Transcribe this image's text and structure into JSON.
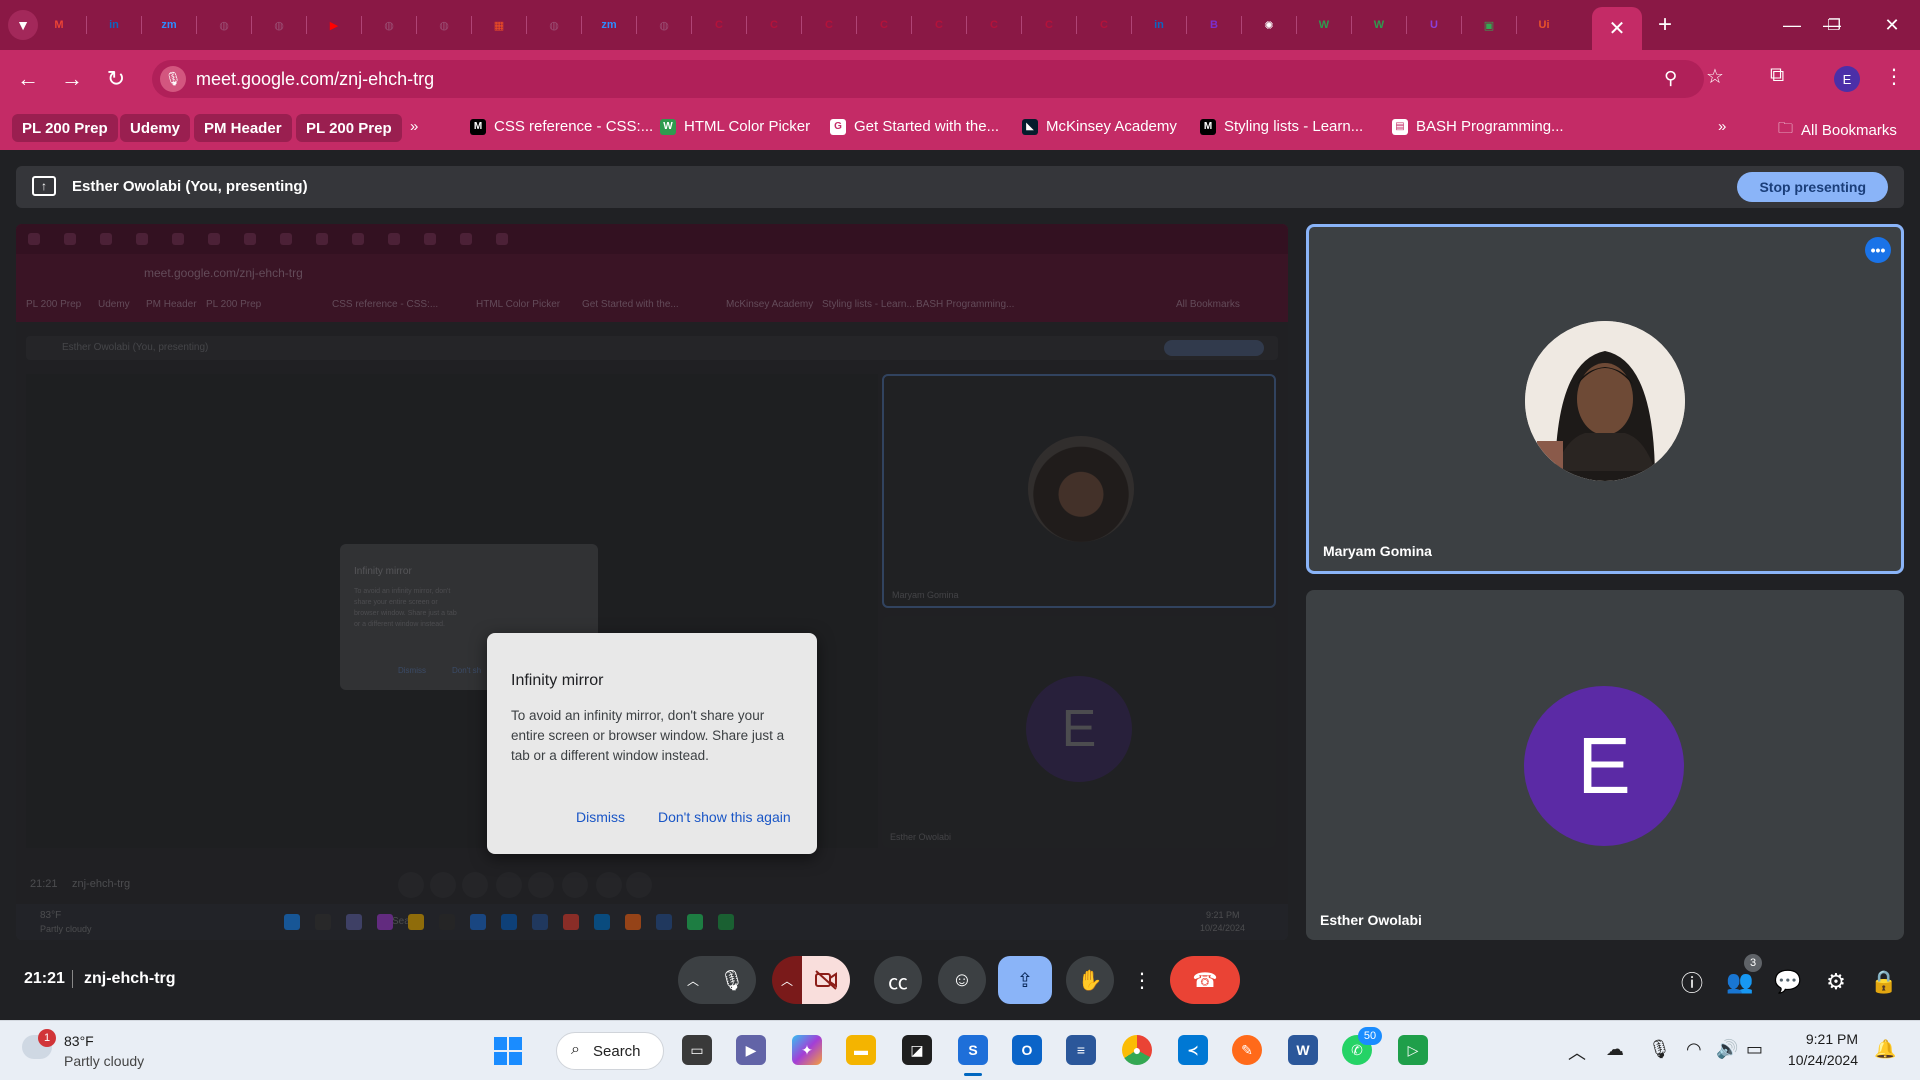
{
  "browser": {
    "tabs": [
      {
        "icon": "gmail-icon",
        "glyph": "M",
        "color": "#ea4335"
      },
      {
        "icon": "linkedin-icon",
        "glyph": "in",
        "color": "#0a66c2"
      },
      {
        "icon": "zoom-icon",
        "glyph": "zm",
        "color": "#2d8cff"
      },
      {
        "icon": "globe-icon",
        "glyph": "◍",
        "color": "#9b4f74"
      },
      {
        "icon": "globe-icon",
        "glyph": "◍",
        "color": "#9b4f74"
      },
      {
        "icon": "youtube-icon",
        "glyph": "▶",
        "color": "#ff0000"
      },
      {
        "icon": "globe-icon",
        "glyph": "◍",
        "color": "#9b4f74"
      },
      {
        "icon": "globe-icon",
        "glyph": "◍",
        "color": "#9b4f74"
      },
      {
        "icon": "microsoft-icon",
        "glyph": "▦",
        "color": "#f25022"
      },
      {
        "icon": "globe-icon",
        "glyph": "◍",
        "color": "#9b4f74"
      },
      {
        "icon": "zoom-icon",
        "glyph": "zm",
        "color": "#2d8cff"
      },
      {
        "icon": "globe-icon",
        "glyph": "◍",
        "color": "#9b4f74"
      },
      {
        "icon": "red-c-icon",
        "glyph": "C",
        "color": "#b3123a"
      },
      {
        "icon": "red-c-icon",
        "glyph": "C",
        "color": "#b3123a"
      },
      {
        "icon": "red-c-icon",
        "glyph": "C",
        "color": "#b3123a"
      },
      {
        "icon": "red-c-icon",
        "glyph": "C",
        "color": "#b3123a"
      },
      {
        "icon": "red-c-icon",
        "glyph": "C",
        "color": "#b3123a"
      },
      {
        "icon": "red-c-icon",
        "glyph": "C",
        "color": "#b3123a"
      },
      {
        "icon": "red-c-icon",
        "glyph": "C",
        "color": "#b3123a"
      },
      {
        "icon": "red-c-icon",
        "glyph": "C",
        "color": "#b3123a"
      },
      {
        "icon": "linkedin-icon",
        "glyph": "in",
        "color": "#0a66c2"
      },
      {
        "icon": "b-icon",
        "glyph": "B",
        "color": "#7b2fd0"
      },
      {
        "icon": "openai-icon",
        "glyph": "✺",
        "color": "#ffffff"
      },
      {
        "icon": "w-icon",
        "glyph": "W",
        "color": "#2e9b4f"
      },
      {
        "icon": "w-icon",
        "glyph": "W",
        "color": "#2e9b4f"
      },
      {
        "icon": "u-icon",
        "glyph": "U",
        "color": "#8b3fd9"
      },
      {
        "icon": "meet-icon",
        "glyph": "▣",
        "color": "#34a853"
      },
      {
        "icon": "ui-icon",
        "glyph": "Ui",
        "color": "#e8532a"
      }
    ],
    "active_tab_close": "✕",
    "new_tab": "+",
    "url": "meet.google.com/znj-ehch-trg",
    "profile_initial": "E",
    "bookmark_chips": [
      "PL 200 Prep",
      "Udemy",
      "PM Header",
      "PL 200 Prep"
    ],
    "bookmarks_more": "»",
    "bookmarks": [
      {
        "label": "CSS reference - CSS:...",
        "icon": "mdn-icon",
        "glyph": "M",
        "color": "#000000"
      },
      {
        "label": "HTML Color Picker",
        "icon": "w3schools-icon",
        "glyph": "W",
        "color": "#2e9b4f"
      },
      {
        "label": "Get Started with the...",
        "icon": "google-icon",
        "glyph": "G",
        "color": "#ffffff"
      },
      {
        "label": "McKinsey Academy",
        "icon": "mckinsey-icon",
        "glyph": "◣",
        "color": "#051c2c"
      },
      {
        "label": "Styling lists - Learn...",
        "icon": "mdn-icon",
        "glyph": "M",
        "color": "#000000"
      },
      {
        "label": "BASH Programming...",
        "icon": "page-icon",
        "glyph": "▤",
        "color": "#ffffff"
      }
    ],
    "all_bookmarks": "All Bookmarks"
  },
  "meet": {
    "presenting_label": "Esther Owolabi (You, presenting)",
    "stop_presenting": "Stop presenting",
    "dialog": {
      "title": "Infinity mirror",
      "body": "To avoid an infinity mirror, don't share your entire screen or browser window. Share just a tab or a different window instead.",
      "dismiss": "Dismiss",
      "dont_show": "Don't show this again"
    },
    "participants": [
      {
        "name": "Maryam Gomina",
        "active": true
      },
      {
        "name": "Esther Owolabi",
        "initial": "E"
      }
    ],
    "time": "21:21",
    "code": "znj-ehch-trg",
    "participant_count": "3",
    "mirror": {
      "url": "meet.google.com/znj-ehch-trg",
      "bookmarks": [
        "PL 200 Prep",
        "Udemy",
        "PM Header",
        "PL 200 Prep",
        "CSS reference - CSS:...",
        "HTML Color Picker",
        "Get Started with the...",
        "McKinsey Academy",
        "Styling lists - Learn...",
        "BASH Programming...",
        "All Bookmarks"
      ],
      "presenting": "Esther Owolabi (You, presenting)",
      "stop": "Stop presenting",
      "dialog_title": "Infinity mirror",
      "dialog_body": "To avoid an infinity mirror, don't share your entire screen or browser window. Share just a tab or a different window instead.",
      "dismiss": "Dismiss",
      "dont_show": "Don't sh",
      "tile1_name": "Maryam Gomina",
      "tile2_name": "Esther Owolabi",
      "initial": "E",
      "time": "21:21",
      "code": "znj-ehch-trg",
      "weather_temp": "83°F",
      "weather_desc": "Partly cloudy",
      "search": "Search",
      "clock_time": "9:21 PM",
      "clock_date": "10/24/2024"
    }
  },
  "taskbar": {
    "weather_badge": "1",
    "temp": "83°F",
    "condition": "Partly cloudy",
    "search": "Search",
    "whatsapp_badge": "50",
    "time": "9:21 PM",
    "date": "10/24/2024"
  },
  "colors": {
    "tabstrip": "#8a1845",
    "toolbar": "#c42b66",
    "accent_blue": "#8ab4f8",
    "end_call_red": "#ea4335",
    "avatar_purple": "#5b2aa5"
  }
}
